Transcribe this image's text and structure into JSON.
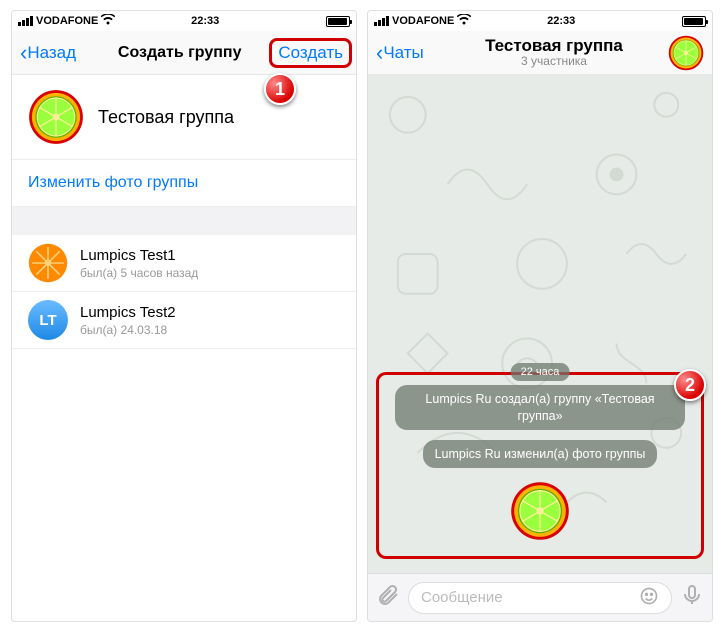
{
  "status": {
    "carrier": "VODAFONE",
    "time": "22:33"
  },
  "left": {
    "back": "Назад",
    "title": "Создать группу",
    "create": "Создать",
    "group_name": "Тестовая группа",
    "change_photo": "Изменить фото группы",
    "members": [
      {
        "name": "Lumpics Test1",
        "status": "был(а) 5 часов назад",
        "avatar_type": "orange-citrus"
      },
      {
        "name": "Lumpics Test2",
        "status": "был(а) 24.03.18",
        "avatar_type": "blue-initials",
        "initials": "LT"
      }
    ]
  },
  "right": {
    "back": "Чаты",
    "title": "Тестовая группа",
    "subtitle": "3 участника",
    "date_label": "22 часа",
    "sys_msgs": [
      "Lumpics Ru создал(а) группу «Тестовая группа»",
      "Lumpics Ru изменил(а) фото группы"
    ],
    "input_placeholder": "Сообщение"
  },
  "badges": {
    "one": "1",
    "two": "2"
  }
}
